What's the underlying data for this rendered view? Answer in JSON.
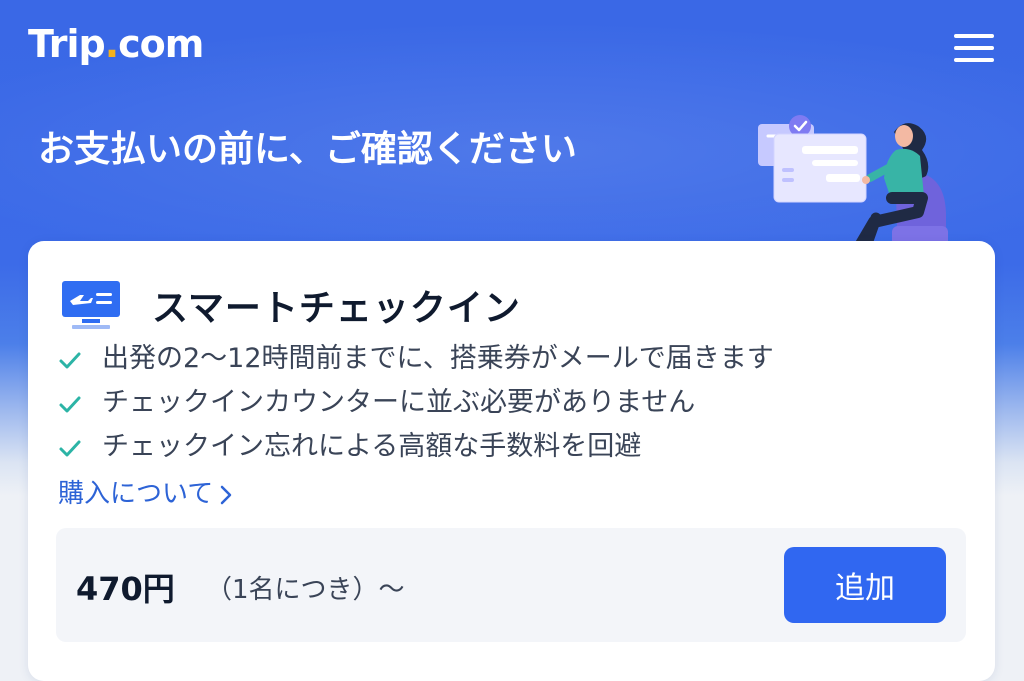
{
  "header": {
    "logo_text_main": "Trip",
    "logo_text_dot": ".",
    "logo_text_tld": "com",
    "menu_icon": "hamburger-menu-icon"
  },
  "page": {
    "headline": "お支払いの前に、ご確認ください"
  },
  "service": {
    "icon": "flight-checkin-monitor-icon",
    "title": "スマートチェックイン",
    "benefits": [
      "出発の2〜12時間前までに、搭乗券がメールで届きます",
      "チェックインカウンターに並ぶ必要がありません",
      "チェックイン忘れによる高額な手数料を回避"
    ],
    "more_link": "購入について"
  },
  "pricing": {
    "price": "470円",
    "per_unit": "（1名につき）〜",
    "add_button": "追加"
  },
  "colors": {
    "brand_blue": "#3a68e6",
    "accent_button": "#3067f1",
    "link": "#2d63d6",
    "check": "#2cb4a6",
    "logo_dot": "#f5b21b"
  }
}
